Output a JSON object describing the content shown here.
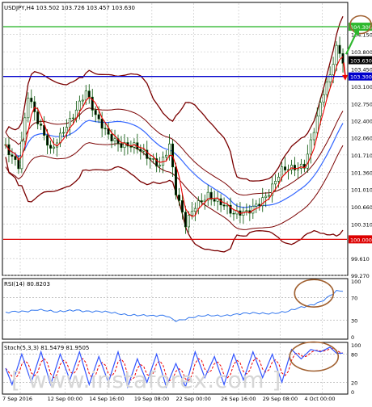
{
  "chart_data": {
    "type": "candlestick",
    "header": "USDJPY,H4  103.502 103.726 103.457 103.630",
    "price_axis": {
      "range": [
        99.27,
        104.8
      ],
      "ticks": [
        "104.150",
        "103.800",
        "103.450",
        "103.100",
        "102.750",
        "102.400",
        "102.060",
        "101.710",
        "101.360",
        "101.010",
        "100.660",
        "100.310",
        "99.610",
        "99.270"
      ]
    },
    "price_tags": [
      {
        "value": 104.308,
        "label": "104.308",
        "color": "#2eb82e"
      },
      {
        "value": 103.63,
        "label": "103.630",
        "color": "#000000"
      },
      {
        "value": 103.3,
        "label": "103.300",
        "color": "#0000cc"
      },
      {
        "value": 100.0,
        "label": "100.000",
        "color": "#dd0000"
      }
    ],
    "horizontal_lines": [
      {
        "name": "resistance-green",
        "value": 104.308,
        "color": "#2eb82e"
      },
      {
        "name": "support-blue",
        "value": 103.3,
        "color": "#0000cc"
      },
      {
        "name": "support-red",
        "value": 100.0,
        "color": "#dd0000"
      }
    ],
    "x_labels": [
      "7 Sep 2016",
      "12 Sep 00:00",
      "14 Sep 16:00",
      "19 Sep 08:00",
      "22 Sep 00:00",
      "26 Sep 16:00",
      "29 Sep 08:00",
      "4 Oct 00:00"
    ],
    "close_keys": [
      [
        0,
        101.85
      ],
      [
        4,
        101.55
      ],
      [
        7,
        102.95
      ],
      [
        10,
        102.35
      ],
      [
        14,
        101.75
      ],
      [
        18,
        102.25
      ],
      [
        21,
        102.55
      ],
      [
        25,
        102.95
      ],
      [
        28,
        102.45
      ],
      [
        32,
        102.15
      ],
      [
        36,
        101.95
      ],
      [
        40,
        101.85
      ],
      [
        44,
        101.65
      ],
      [
        48,
        101.55
      ],
      [
        51,
        101.95
      ],
      [
        53,
        100.95
      ],
      [
        56,
        100.25
      ],
      [
        59,
        100.65
      ],
      [
        63,
        100.95
      ],
      [
        67,
        100.75
      ],
      [
        71,
        100.45
      ],
      [
        75,
        100.55
      ],
      [
        78,
        100.75
      ],
      [
        82,
        100.95
      ],
      [
        86,
        101.35
      ],
      [
        90,
        101.45
      ],
      [
        93,
        101.55
      ],
      [
        96,
        102.25
      ],
      [
        99,
        102.95
      ],
      [
        101,
        103.25
      ],
      [
        103,
        103.85
      ],
      [
        105,
        103.63
      ]
    ],
    "rsi": {
      "label": "RSI(14) 80.8203",
      "range": [
        0,
        100
      ],
      "ticks": [
        "100",
        "70",
        "30",
        "0"
      ],
      "levels": [
        70,
        30
      ],
      "keys": [
        [
          0,
          42
        ],
        [
          6,
          46
        ],
        [
          10,
          50
        ],
        [
          16,
          43
        ],
        [
          22,
          49
        ],
        [
          28,
          45
        ],
        [
          34,
          42
        ],
        [
          40,
          40
        ],
        [
          46,
          36
        ],
        [
          50,
          38
        ],
        [
          53,
          30
        ],
        [
          58,
          34
        ],
        [
          64,
          38
        ],
        [
          70,
          40
        ],
        [
          76,
          41
        ],
        [
          82,
          43
        ],
        [
          88,
          45
        ],
        [
          94,
          55
        ],
        [
          98,
          64
        ],
        [
          101,
          74
        ],
        [
          103,
          81
        ],
        [
          105,
          81
        ]
      ]
    },
    "stoch": {
      "label": "Stoch(5,3,3) 81.5479 81.9505",
      "range": [
        0,
        100
      ],
      "ticks": [
        "100",
        "80",
        "20",
        "0"
      ],
      "levels": [
        80,
        20
      ],
      "keys": [
        [
          0,
          50
        ],
        [
          2,
          15
        ],
        [
          5,
          80
        ],
        [
          8,
          20
        ],
        [
          11,
          85
        ],
        [
          14,
          15
        ],
        [
          17,
          80
        ],
        [
          20,
          25
        ],
        [
          23,
          85
        ],
        [
          26,
          15
        ],
        [
          29,
          75
        ],
        [
          32,
          20
        ],
        [
          35,
          85
        ],
        [
          38,
          10
        ],
        [
          41,
          70
        ],
        [
          44,
          20
        ],
        [
          47,
          80
        ],
        [
          50,
          10
        ],
        [
          53,
          60
        ],
        [
          56,
          10
        ],
        [
          59,
          85
        ],
        [
          62,
          30
        ],
        [
          65,
          75
        ],
        [
          68,
          15
        ],
        [
          71,
          80
        ],
        [
          74,
          25
        ],
        [
          77,
          85
        ],
        [
          80,
          30
        ],
        [
          83,
          80
        ],
        [
          86,
          20
        ],
        [
          89,
          90
        ],
        [
          92,
          70
        ],
        [
          95,
          90
        ],
        [
          98,
          85
        ],
        [
          101,
          95
        ],
        [
          103,
          82
        ],
        [
          105,
          82
        ]
      ]
    },
    "colors": {
      "candle_up": "#ffffff",
      "candle_down": "#000000",
      "candle_edge": "#005000",
      "bollinger": "#7a0000",
      "red_ma": "#ee0000",
      "blue_ma": "#3366ff",
      "envelope": "#7a0000",
      "ellipse": "#a06030",
      "arrow_green": "#2eb82e",
      "arrow_red": "#ee0000",
      "rsi_line": "#3377ee",
      "stoch_main": "#3355ff",
      "stoch_signal": "#ee0000",
      "grid": "#c0c0c0",
      "level": "#a0a0a0"
    }
  },
  "watermark": {
    "text": "[ www.instaforex.com ]"
  }
}
